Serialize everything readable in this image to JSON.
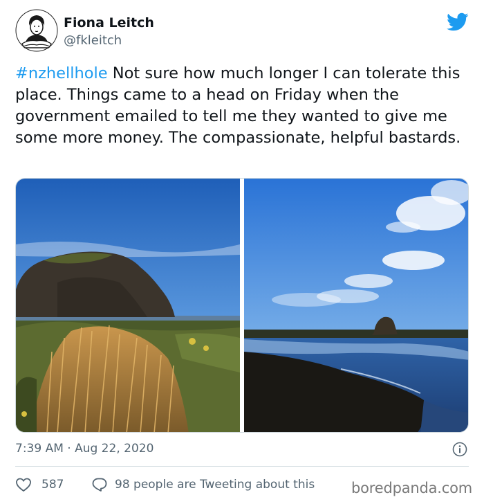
{
  "author": {
    "name": "Fiona Leitch",
    "handle": "@fkleitch"
  },
  "tweet": {
    "hashtag": "#nzhellhole",
    "body": " Not sure how much longer I can tolerate this place. Things came to a head on Friday when the government emailed to tell me they wanted to give me some more money. The compassionate, helpful bastards."
  },
  "meta": {
    "timestamp": "7:39 AM · Aug 22, 2020"
  },
  "actions": {
    "likes": "587",
    "tweeting": "98 people are Tweeting about this"
  },
  "watermark": "boredpanda.com",
  "icons": {
    "avatar": "avatar-illustration",
    "brand": "twitter-bird-icon",
    "info": "info-icon",
    "like": "heart-icon",
    "reply": "speech-bubble-icon"
  },
  "colors": {
    "accent": "#1d9bf0",
    "muted": "#536471",
    "text": "#0f1419"
  }
}
